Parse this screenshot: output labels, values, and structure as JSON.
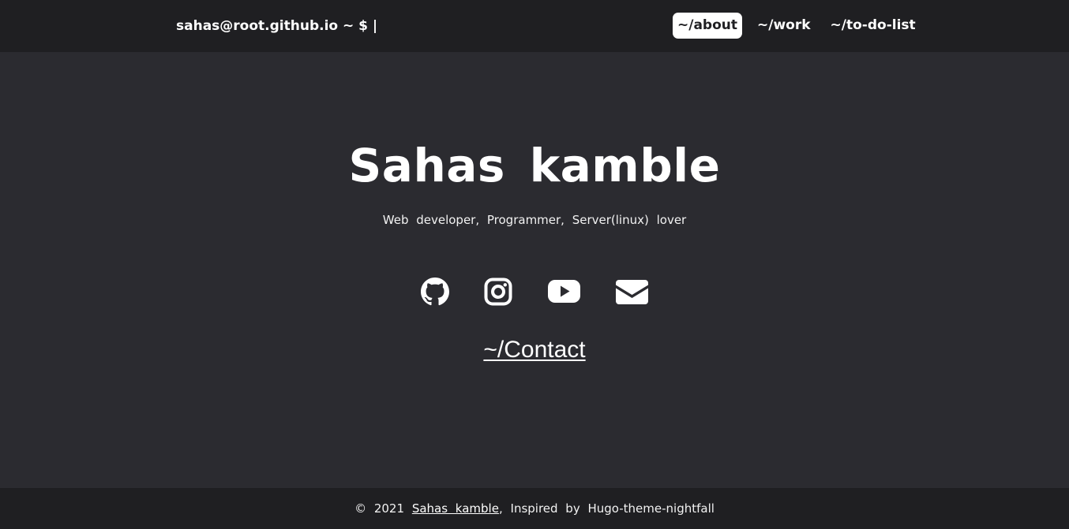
{
  "header": {
    "prompt": "sahas@root.github.io ~ $ |",
    "nav": [
      {
        "label": "~/about",
        "active": true
      },
      {
        "label": "~/work",
        "active": false
      },
      {
        "label": "~/to-do-list",
        "active": false
      }
    ]
  },
  "hero": {
    "name": "Sahas kamble",
    "tagline": "Web developer, Programmer, Server(linux) lover"
  },
  "social": [
    {
      "icon": "github-icon"
    },
    {
      "icon": "instagram-icon"
    },
    {
      "icon": "youtube-icon"
    },
    {
      "icon": "mail-icon"
    }
  ],
  "contact": {
    "label": "~/Contact"
  },
  "footer": {
    "copyright": "© 2021",
    "author": "Sahas kamble",
    "separator": ",",
    "credit": "Inspired by Hugo-theme-nightfall"
  },
  "colors": {
    "background": "#2b2b30",
    "bar": "#1f1f22",
    "text": "#ffffff"
  }
}
